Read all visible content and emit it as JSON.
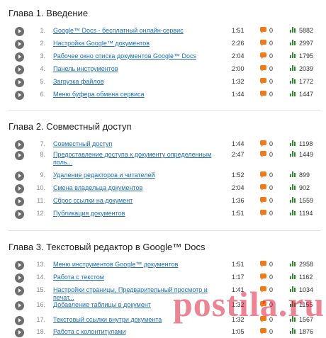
{
  "chapters": [
    {
      "title": "Глава 1. Введение",
      "items": [
        {
          "num": "1.",
          "title": "Google™ Docs - бесплатный онлайн-сервис",
          "duration": "1:51",
          "comments": "0",
          "views": "5882"
        },
        {
          "num": "2.",
          "title": "Настройка Google™ документов",
          "duration": "2:26",
          "comments": "0",
          "views": "2997"
        },
        {
          "num": "3.",
          "title": "Рабочее окно списка документов Google™ Docs",
          "duration": "2:04",
          "comments": "0",
          "views": "1795"
        },
        {
          "num": "4.",
          "title": "Панель инструментов",
          "duration": "2:00",
          "comments": "0",
          "views": "2039"
        },
        {
          "num": "5.",
          "title": "Загрузка файлов",
          "duration": "1:32",
          "comments": "0",
          "views": "1772"
        },
        {
          "num": "6.",
          "title": "Меню буфера обмена сервиса",
          "duration": "1:44",
          "comments": "0",
          "views": "1447"
        }
      ]
    },
    {
      "title": "Глава 2. Совместный доступ",
      "items": [
        {
          "num": "7.",
          "title": "Совместный доступ",
          "duration": "1:44",
          "comments": "0",
          "views": "1198"
        },
        {
          "num": "8.",
          "title": "Предоставление доступа к документу определенным поль...",
          "duration": "2:47",
          "comments": "0",
          "views": "1449"
        },
        {
          "num": "9.",
          "title": "Удаление редакторов и читателей",
          "duration": "1:52",
          "comments": "0",
          "views": "899"
        },
        {
          "num": "10.",
          "title": "Смена владельца документов",
          "duration": "2:04",
          "comments": "0",
          "views": "902"
        },
        {
          "num": "11.",
          "title": "Сброс ссылки на документ",
          "duration": "1:36",
          "comments": "0",
          "views": "1559"
        },
        {
          "num": "12.",
          "title": "Публикация документов",
          "duration": "1:51",
          "comments": "0",
          "views": "1194"
        }
      ]
    },
    {
      "title": "Глава 3. Текстовый редактор в Google™ Docs",
      "items": [
        {
          "num": "13.",
          "title": "Меню инструментов Google™ документов",
          "duration": "1:51",
          "comments": "0",
          "views": "2958"
        },
        {
          "num": "14.",
          "title": "Работа с текстом",
          "duration": "1:17",
          "comments": "0",
          "views": "1162"
        },
        {
          "num": "15.",
          "title": "Настройки страницы, Предварительный просмотр и печат...",
          "duration": "1:41",
          "comments": "0",
          "views": "1034"
        },
        {
          "num": "16.",
          "title": "Добавление таблицы в документ",
          "duration": "1:32",
          "comments": "0",
          "views": "1155"
        },
        {
          "num": "17.",
          "title": "Текстовый ссылки внутри документа",
          "duration": "1:32",
          "comments": "0",
          "views": "1567"
        },
        {
          "num": "18.",
          "title": "Работа с колонтитулами",
          "duration": "1:05",
          "comments": "0",
          "views": "1876"
        }
      ]
    }
  ],
  "watermark": "postila.ru",
  "icons": {
    "play": "play-icon",
    "comment": "comment-icon",
    "views": "views-chart-icon"
  },
  "colors": {
    "link": "#1f6fb6",
    "comment": "#ef7b1a",
    "views": "#2e8a2e",
    "watermark": "#d80e2e"
  }
}
